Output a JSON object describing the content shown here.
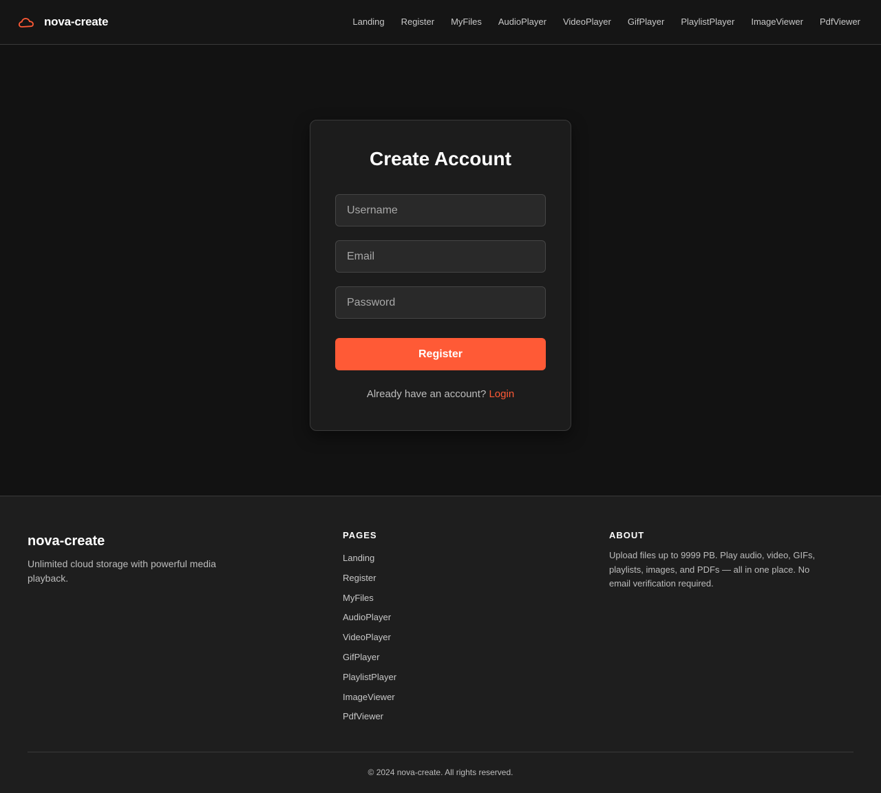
{
  "header": {
    "brand": "nova-create",
    "nav": [
      {
        "label": "Landing"
      },
      {
        "label": "Register"
      },
      {
        "label": "MyFiles"
      },
      {
        "label": "AudioPlayer"
      },
      {
        "label": "VideoPlayer"
      },
      {
        "label": "GifPlayer"
      },
      {
        "label": "PlaylistPlayer"
      },
      {
        "label": "ImageViewer"
      },
      {
        "label": "PdfViewer"
      }
    ]
  },
  "form": {
    "title": "Create Account",
    "username": {
      "value": "",
      "placeholder": "Username"
    },
    "email": {
      "value": "",
      "placeholder": "Email"
    },
    "password": {
      "value": "",
      "placeholder": "Password"
    },
    "submit_label": "Register",
    "login_prompt": "Already have an account?",
    "login_link": "Login"
  },
  "footer": {
    "brand": "nova-create",
    "tagline": "Unlimited cloud storage with powerful media playback.",
    "pages_heading": "PAGES",
    "pages": [
      {
        "label": "Landing"
      },
      {
        "label": "Register"
      },
      {
        "label": "MyFiles"
      },
      {
        "label": "AudioPlayer"
      },
      {
        "label": "VideoPlayer"
      },
      {
        "label": "GifPlayer"
      },
      {
        "label": "PlaylistPlayer"
      },
      {
        "label": "ImageViewer"
      },
      {
        "label": "PdfViewer"
      }
    ],
    "about_heading": "ABOUT",
    "about_text": "Upload files up to 9999 PB. Play audio, video, GIFs, playlists, images, and PDFs — all in one place. No email verification required.",
    "copyright": "© 2024 nova-create. All rights reserved."
  },
  "colors": {
    "accent": "#ff5a36",
    "background": "#121212",
    "card": "#1c1c1c",
    "footer": "#1e1e1e"
  },
  "icons": {
    "brand": "cloud-icon"
  }
}
